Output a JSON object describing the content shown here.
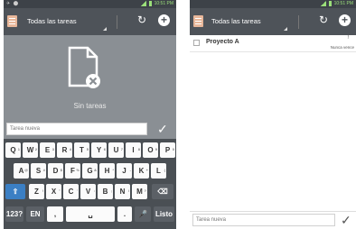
{
  "left_screen": {
    "status": {
      "left": "✈ ⬤",
      "time": "10:51 PM"
    },
    "list_title": "Todas las tareas",
    "empty_text": "Sin tareas",
    "input_placeholder": "Tarea nueva",
    "keyboard": {
      "row1": [
        {
          "k": "Q",
          "s": "1"
        },
        {
          "k": "W",
          "s": "2"
        },
        {
          "k": "E",
          "s": "3"
        },
        {
          "k": "R",
          "s": "4"
        },
        {
          "k": "T",
          "s": "5"
        },
        {
          "k": "Y",
          "s": "6"
        },
        {
          "k": "U",
          "s": "7"
        },
        {
          "k": "I",
          "s": "8"
        },
        {
          "k": "O",
          "s": "9"
        },
        {
          "k": "P",
          "s": "0"
        }
      ],
      "row2": [
        {
          "k": "A",
          "s": "@"
        },
        {
          "k": "S",
          "s": "#"
        },
        {
          "k": "D",
          "s": "$"
        },
        {
          "k": "F",
          "s": "%"
        },
        {
          "k": "G",
          "s": "&"
        },
        {
          "k": "H",
          "s": "*"
        },
        {
          "k": "J",
          "s": "-"
        },
        {
          "k": "K",
          "s": "+"
        },
        {
          "k": "L",
          "s": "("
        }
      ],
      "row3": [
        {
          "k": "Z",
          "s": "!"
        },
        {
          "k": "X",
          "s": "\""
        },
        {
          "k": "C",
          "s": "'"
        },
        {
          "k": "V",
          "s": ":"
        },
        {
          "k": "B",
          "s": ";"
        },
        {
          "k": "N",
          "s": "/"
        },
        {
          "k": "M",
          "s": "?"
        }
      ],
      "shift_icon": "⇧",
      "delete_icon": "⌫",
      "sym_key": "123?",
      "lang_key": "EN",
      "comma_key": ",",
      "space_icon": "␣",
      "period_key": ".",
      "mic_icon": "🎤",
      "done_key": "Listo"
    }
  },
  "right_screen": {
    "status": {
      "time": "10:51 PM"
    },
    "list_title": "Todas las tareas",
    "task": {
      "name": "Proyecto A",
      "due": "Nunca vence",
      "priority_mark": "!"
    },
    "input_placeholder": "Tarea nueva"
  },
  "icons": {
    "sync": "↻",
    "add": "+",
    "check": "✓"
  },
  "colors": {
    "action_bar": "#4e5359",
    "keyboard_bg": "#4a4f54",
    "accent_blue": "#3b7fc4"
  }
}
